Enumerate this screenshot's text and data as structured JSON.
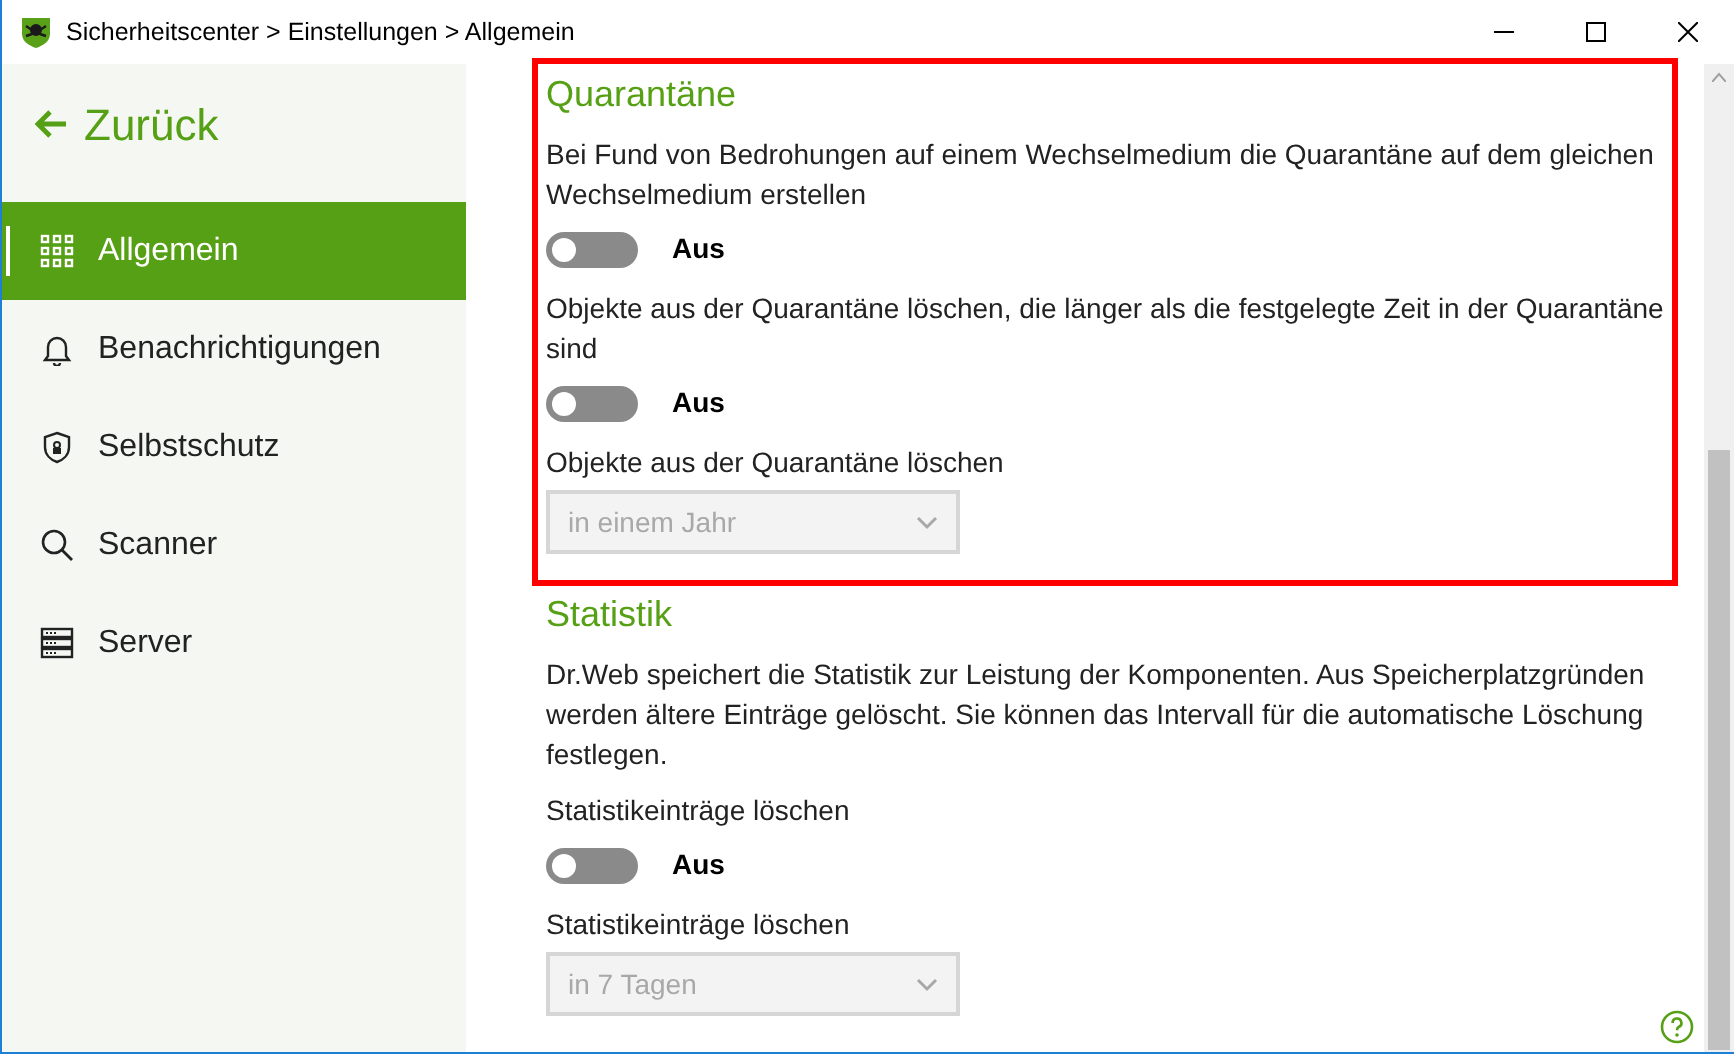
{
  "window": {
    "title": "Sicherheitscenter > Einstellungen > Allgemein"
  },
  "back": {
    "label": "Zurück"
  },
  "sidebar": {
    "items": [
      {
        "label": "Allgemein",
        "kind": "grid",
        "selected": true
      },
      {
        "label": "Benachrichtigungen",
        "kind": "bell",
        "selected": false
      },
      {
        "label": "Selbstschutz",
        "kind": "shield",
        "selected": false
      },
      {
        "label": "Scanner",
        "kind": "search",
        "selected": false
      },
      {
        "label": "Server",
        "kind": "server",
        "selected": false
      }
    ]
  },
  "sections": [
    {
      "heading": "Quarantäne",
      "highlighted": true,
      "items": [
        {
          "kind": "text",
          "text": "Bei Fund von Bedrohungen auf einem Wechselmedium die Quarantäne auf dem gleichen Wechselmedium erstellen"
        },
        {
          "kind": "toggle",
          "on": false,
          "label": "Aus"
        },
        {
          "kind": "text",
          "text": "Objekte aus der Quarantäne löschen, die länger als die festgelegte Zeit in der Quarantäne sind"
        },
        {
          "kind": "toggle",
          "on": false,
          "label": "Aus"
        },
        {
          "kind": "text",
          "text": "Objekte aus der Quarantäne löschen"
        },
        {
          "kind": "dropdown",
          "value": "in einem Jahr",
          "disabled": true
        }
      ]
    },
    {
      "heading": "Statistik",
      "highlighted": false,
      "items": [
        {
          "kind": "text",
          "text": "Dr.Web speichert die Statistik zur Leistung der Komponenten. Aus Speicherplatzgründen werden ältere Einträge gelöscht. Sie können das Intervall für die automatische Löschung festlegen."
        },
        {
          "kind": "text",
          "text": "Statistikeinträge löschen"
        },
        {
          "kind": "toggle",
          "on": false,
          "label": "Aus"
        },
        {
          "kind": "text",
          "text": "Statistikeinträge löschen"
        },
        {
          "kind": "dropdown",
          "value": "in 7 Tagen",
          "disabled": true
        }
      ]
    }
  ]
}
